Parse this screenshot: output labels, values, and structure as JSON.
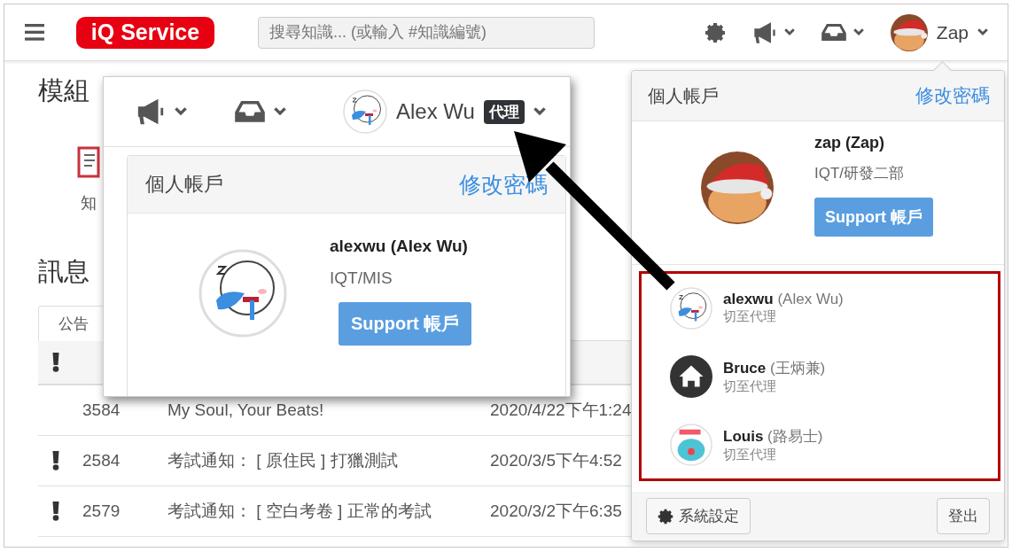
{
  "header": {
    "logo": "iQ Service",
    "search": {
      "placeholder": "搜尋知識... (或輸入 #知識編號)"
    },
    "user_name": "Zap"
  },
  "modules": {
    "title": "模組",
    "items": [
      {
        "label": "知"
      }
    ]
  },
  "messages": {
    "title": "訊息",
    "tabs": [
      {
        "label": "公告",
        "selected": true
      }
    ],
    "rows": [
      {
        "important": false,
        "id": "3584",
        "subject": "My Soul, Your Beats!",
        "date": "2020/4/22下午1:24"
      },
      {
        "important": true,
        "id": "2584",
        "subject": "考試通知： [ 原住民 ] 打獵測試",
        "date": "2020/3/5下午4:52"
      },
      {
        "important": true,
        "id": "2579",
        "subject": "考試通知： [ 空白考卷 ] 正常的考試",
        "date": "2020/3/2下午6:35"
      }
    ]
  },
  "account_menu": {
    "title": "個人帳戶",
    "change_password": "修改密碼",
    "profile": {
      "name": "zap (Zap)",
      "department": "IQT/研發二部",
      "button": "Support 帳戶"
    },
    "proxies": [
      {
        "username": "alexwu",
        "full_name": "(Alex Wu)",
        "action": "切至代理",
        "kind": "sticker"
      },
      {
        "username": "Bruce",
        "full_name": "(王炳兼)",
        "action": "切至代理",
        "kind": "house"
      },
      {
        "username": "Louis",
        "full_name": "(路易士)",
        "action": "切至代理",
        "kind": "cat"
      }
    ],
    "settings_button": "系統設定",
    "logout_button": "登出"
  },
  "zoom_inset": {
    "user_name": "Alex Wu",
    "badge": "代理",
    "panel": {
      "title": "個人帳戶",
      "change_password": "修改密碼",
      "name": "alexwu (Alex Wu)",
      "department": "IQT/MIS",
      "button": "Support 帳戶"
    }
  }
}
